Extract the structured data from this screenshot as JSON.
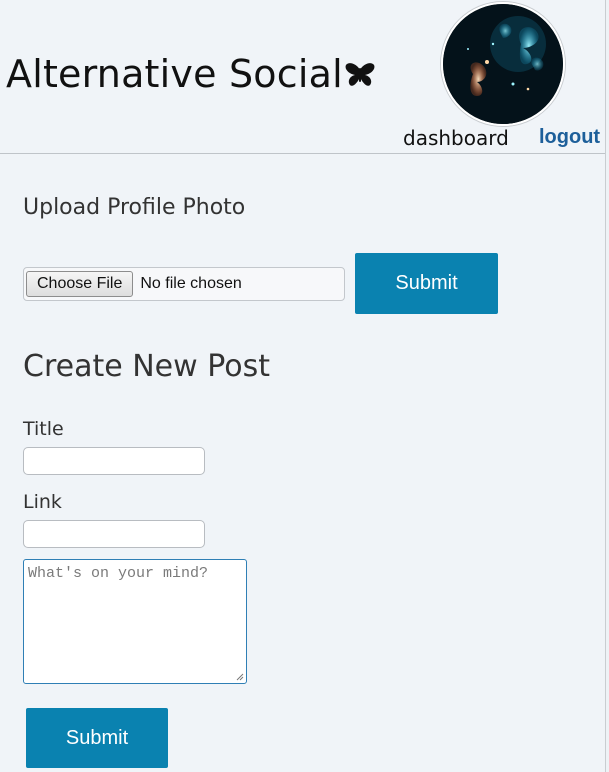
{
  "app": {
    "brand": "Alternative Social",
    "brand_icon": "butterfly-icon",
    "avatar": "profile-photo-butterflies"
  },
  "nav": {
    "dashboard": "dashboard",
    "logout": "logout",
    "logout_color": "#1d5f9a"
  },
  "upload": {
    "title": "Upload Profile Photo",
    "choose_label": "Choose File",
    "file_status": "No file chosen",
    "submit_label": "Submit"
  },
  "post": {
    "title": "Create New Post",
    "title_label": "Title",
    "title_value": "",
    "link_label": "Link",
    "link_value": "",
    "body_placeholder": "What's on your mind?",
    "submit_label": "Submit"
  },
  "colors": {
    "accent": "#0a82b0",
    "background": "#f0f4f8"
  }
}
